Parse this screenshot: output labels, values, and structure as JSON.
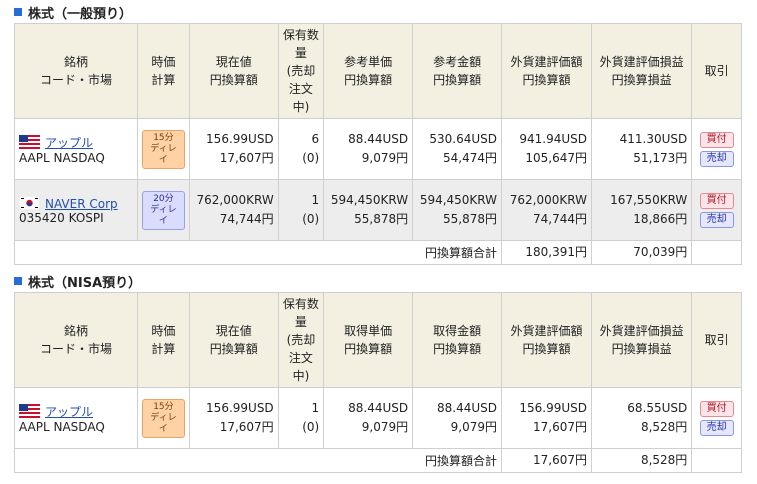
{
  "colors": {
    "accent": "#2a6cd6",
    "header_bg": "#f3f0e2",
    "buy": "#b3152a",
    "sell": "#2432a8"
  },
  "section1": {
    "title": "株式（一般預り）",
    "headers": {
      "name": [
        "銘柄",
        "コード・市場"
      ],
      "timing": [
        "時価",
        "計算"
      ],
      "price": [
        "現在値",
        "円換算額"
      ],
      "qty": [
        "保有数",
        "量",
        "(売却",
        "注文",
        "中)"
      ],
      "unit": [
        "参考単価",
        "円換算額"
      ],
      "amount": [
        "参考金額",
        "円換算額"
      ],
      "fx_eval": [
        "外貨建評価額",
        "円換算額"
      ],
      "fx_pl": [
        "外貨建評価損益",
        "円換算損益"
      ],
      "trade": [
        "取引"
      ]
    },
    "rows": [
      {
        "name_link": "アップル",
        "code_market": "AAPL NASDAQ",
        "flag": "us-flag-icon",
        "delay": [
          "15分",
          "ディレイ"
        ],
        "price": "156.99USD",
        "price_jpy": "17,607円",
        "qty": "6",
        "qty_sub": "(0)",
        "unit": "88.44USD",
        "unit_jpy": "9,079円",
        "amount": "530.64USD",
        "amount_jpy": "54,474円",
        "fx_eval": "941.94USD",
        "fx_eval_jpy": "105,647円",
        "fx_pl": "411.30USD",
        "fx_pl_jpy": "51,173円",
        "buy": "買付",
        "sell": "売却"
      },
      {
        "name_link": "NAVER Corp",
        "code_market": "035420 KOSPI",
        "flag": "kr-flag-icon",
        "delay": [
          "20分",
          "ディレイ"
        ],
        "price": "762,000KRW",
        "price_jpy": "74,744円",
        "qty": "1",
        "qty_sub": "(0)",
        "unit": "594,450KRW",
        "unit_jpy": "55,878円",
        "amount": "594,450KRW",
        "amount_jpy": "55,878円",
        "fx_eval": "762,000KRW",
        "fx_eval_jpy": "74,744円",
        "fx_pl": "167,550KRW",
        "fx_pl_jpy": "18,866円",
        "buy": "買付",
        "sell": "売却"
      }
    ],
    "total": {
      "label": "円換算額合計",
      "eval": "180,391円",
      "pl": "70,039円"
    }
  },
  "section2": {
    "title": "株式（NISA預り）",
    "headers": {
      "name": [
        "銘柄",
        "コード・市場"
      ],
      "timing": [
        "時価",
        "計算"
      ],
      "price": [
        "現在値",
        "円換算額"
      ],
      "qty": [
        "保有数",
        "量",
        "(売却",
        "注文",
        "中)"
      ],
      "unit": [
        "取得単価",
        "円換算額"
      ],
      "amount": [
        "取得金額",
        "円換算額"
      ],
      "fx_eval": [
        "外貨建評価額",
        "円換算額"
      ],
      "fx_pl": [
        "外貨建評価損益",
        "円換算損益"
      ],
      "trade": [
        "取引"
      ]
    },
    "rows": [
      {
        "name_link": "アップル",
        "code_market": "AAPL NASDAQ",
        "flag": "us-flag-icon",
        "delay": [
          "15分",
          "ディレイ"
        ],
        "price": "156.99USD",
        "price_jpy": "17,607円",
        "qty": "1",
        "qty_sub": "(0)",
        "unit": "88.44USD",
        "unit_jpy": "9,079円",
        "amount": "88.44USD",
        "amount_jpy": "9,079円",
        "fx_eval": "156.99USD",
        "fx_eval_jpy": "17,607円",
        "fx_pl": "68.55USD",
        "fx_pl_jpy": "8,528円",
        "buy": "買付",
        "sell": "売却"
      }
    ],
    "total": {
      "label": "円換算額合計",
      "eval": "17,607円",
      "pl": "8,528円"
    }
  }
}
